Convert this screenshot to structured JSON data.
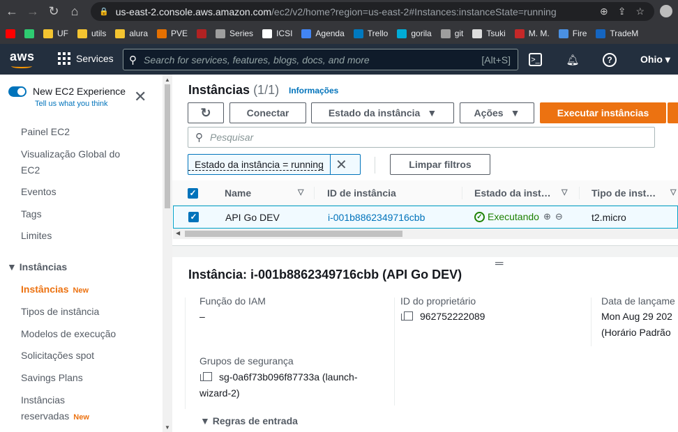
{
  "browser": {
    "url_host": "us-east-2.console.aws.amazon.com",
    "url_path": "/ec2/v2/home?region=us-east-2#Instances:instanceState=running",
    "bookmarks": [
      {
        "label": "",
        "color": "#ff0000"
      },
      {
        "label": "",
        "color": "#2ecc71"
      },
      {
        "label": "UF",
        "color": "#f4c430"
      },
      {
        "label": "utils",
        "color": "#f4c430"
      },
      {
        "label": "alura",
        "color": "#f4c430"
      },
      {
        "label": "PVE",
        "color": "#e57000"
      },
      {
        "label": "",
        "color": "#b22222"
      },
      {
        "label": "Series",
        "color": "#9e9e9e"
      },
      {
        "label": "ICSI",
        "color": "#ffffff"
      },
      {
        "label": "Agenda",
        "color": "#4285f4"
      },
      {
        "label": "Trello",
        "color": "#0079bf"
      },
      {
        "label": "gorila",
        "color": "#00acd7"
      },
      {
        "label": "git",
        "color": "#9e9e9e"
      },
      {
        "label": "Tsuki",
        "color": "#dddddd"
      },
      {
        "label": "M. M.",
        "color": "#c62828"
      },
      {
        "label": "Fire",
        "color": "#4a90e2"
      },
      {
        "label": "TradeM",
        "color": "#1565c0"
      }
    ]
  },
  "aws_header": {
    "logo": "aws",
    "services_label": "Services",
    "search_placeholder": "Search for services, features, blogs, docs, and more",
    "search_shortcut": "[Alt+S]",
    "region": "Ohio ▾"
  },
  "sidebar": {
    "experience_title": "New EC2 Experience",
    "experience_link": "Tell us what you think",
    "items": [
      {
        "label": "Painel EC2"
      },
      {
        "label": "Visualização Global do EC2"
      },
      {
        "label": "Eventos"
      },
      {
        "label": "Tags"
      },
      {
        "label": "Limites"
      }
    ],
    "section": "▼ Instâncias",
    "section_items": [
      {
        "label": "Instâncias",
        "tag": "New"
      },
      {
        "label": "Tipos de instância"
      },
      {
        "label": "Modelos de execução"
      },
      {
        "label": "Solicitações spot"
      },
      {
        "label": "Savings Plans"
      },
      {
        "label": "Instâncias reservadas",
        "tag": "New"
      }
    ]
  },
  "main": {
    "title": "Instâncias",
    "count": "(1/1)",
    "info_link": "Informações",
    "buttons": {
      "connect": "Conectar",
      "state": "Estado da instância",
      "actions": "Ações",
      "launch": "Executar instâncias"
    },
    "search_placeholder": "Pesquisar",
    "filter_token": "Estado da instância = running",
    "clear_filters": "Limpar filtros",
    "columns": [
      "Name",
      "ID de instância",
      "Estado da inst…",
      "Tipo de inst…"
    ],
    "row": {
      "name": "API Go DEV",
      "instance_id": "i-001b8862349716cbb",
      "state": "Executando",
      "type": "t2.micro"
    }
  },
  "details": {
    "title": "Instância: i-001b8862349716cbb (API Go DEV)",
    "iam_label": "Função do IAM",
    "iam_value": "–",
    "owner_label": "ID do proprietário",
    "owner_value": "962752222089",
    "launch_label": "Data de lançame",
    "launch_value_1": "Mon Aug 29 202",
    "launch_value_2": "(Horário Padrão",
    "sg_label": "Grupos de segurança",
    "sg_value_1": "sg-0a6f73b096f87733a (launch-",
    "sg_value_2": "wizard-2)",
    "inbound_rules": "Regras de entrada"
  }
}
